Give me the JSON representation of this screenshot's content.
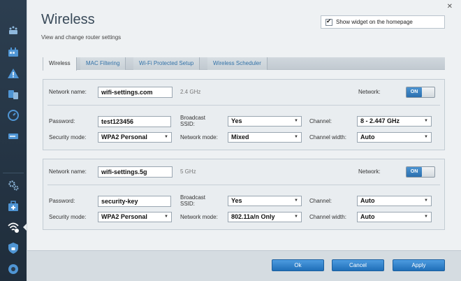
{
  "sidebar": {
    "items": [
      {
        "name": "network-map-icon"
      },
      {
        "name": "router-icon"
      },
      {
        "name": "warning-icon"
      },
      {
        "name": "devices-icon"
      },
      {
        "name": "speed-icon"
      },
      {
        "name": "storage-icon"
      },
      {
        "name": "settings-icon"
      },
      {
        "name": "parental-icon"
      },
      {
        "name": "wireless-icon"
      },
      {
        "name": "security-icon"
      },
      {
        "name": "support-icon"
      }
    ]
  },
  "header": {
    "close": "✕",
    "title": "Wireless",
    "subtitle": "View and change router settings",
    "widget_label": "Show widget on the homepage",
    "widget_checked": true
  },
  "tabs": [
    {
      "label": "Wireless",
      "active": true
    },
    {
      "label": "MAC Filtering"
    },
    {
      "label": "Wi-Fi Protected Setup"
    },
    {
      "label": "Wireless Scheduler"
    }
  ],
  "labels": {
    "network_name": "Network name:",
    "network": "Network:",
    "password": "Password:",
    "broadcast_ssid_1": "Broadcast",
    "broadcast_ssid_2": "SSID:",
    "channel": "Channel:",
    "security_mode": "Security mode:",
    "network_mode": "Network mode:",
    "channel_width": "Channel width:"
  },
  "band24": {
    "network_name": "wifi-settings.com",
    "band": "2.4 GHz",
    "toggle": "ON",
    "password": "test123456",
    "broadcast_ssid": "Yes",
    "channel": "8 - 2.447 GHz",
    "security_mode": "WPA2 Personal",
    "network_mode": "Mixed",
    "channel_width": "Auto"
  },
  "band5": {
    "network_name": "wifi-settings.5g",
    "band": "5 GHz",
    "toggle": "ON",
    "password": "security-key",
    "broadcast_ssid": "Yes",
    "channel": "Auto",
    "security_mode": "WPA2 Personal",
    "network_mode": "802.11a/n Only",
    "channel_width": "Auto"
  },
  "footer": {
    "ok": "Ok",
    "cancel": "Cancel",
    "apply": "Apply"
  },
  "colors": {
    "accent": "#2b6fae",
    "sidebar": "#2c3e50",
    "panel": "#eef1f3"
  }
}
